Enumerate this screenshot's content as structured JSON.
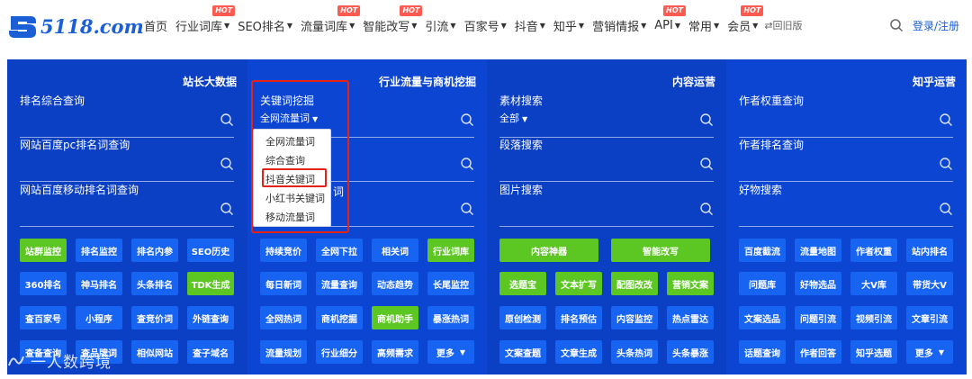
{
  "logo": {
    "text": "5118.com"
  },
  "nav": {
    "items": [
      {
        "label": "首页",
        "dropdown": false,
        "hot": ""
      },
      {
        "label": "行业词库",
        "dropdown": true,
        "hot": "HOT"
      },
      {
        "label": "SEO排名",
        "dropdown": true,
        "hot": ""
      },
      {
        "label": "流量词库",
        "dropdown": true,
        "hot": "HOT"
      },
      {
        "label": "智能改写",
        "dropdown": true,
        "hot": "HOT"
      },
      {
        "label": "引流",
        "dropdown": true,
        "hot": ""
      },
      {
        "label": "百家号",
        "dropdown": true,
        "hot": ""
      },
      {
        "label": "抖音",
        "dropdown": true,
        "hot": ""
      },
      {
        "label": "知乎",
        "dropdown": true,
        "hot": ""
      },
      {
        "label": "营销情报",
        "dropdown": true,
        "hot": ""
      },
      {
        "label": "API",
        "dropdown": true,
        "hot": "HOT"
      },
      {
        "label": "常用",
        "dropdown": true,
        "hot": ""
      },
      {
        "label": "会员",
        "dropdown": true,
        "hot": "HOT"
      }
    ],
    "old_version": "⇄回旧版",
    "login": "登录/注册"
  },
  "columns": [
    {
      "title": "站长大数据",
      "fields": [
        {
          "label": "排名综合查询",
          "sub": ""
        },
        {
          "label": "网站百度pc排名词查询",
          "sub": ""
        },
        {
          "label": "网站百度移动排名词查询",
          "sub": ""
        }
      ],
      "buttons": [
        {
          "label": "站群监控",
          "color": "green"
        },
        {
          "label": "排名监控",
          "color": "blue"
        },
        {
          "label": "排名内参",
          "color": "blue"
        },
        {
          "label": "SEO历史",
          "color": "blue"
        },
        {
          "label": "360排名",
          "color": "blue"
        },
        {
          "label": "神马排名",
          "color": "blue"
        },
        {
          "label": "头条排名",
          "color": "blue"
        },
        {
          "label": "TDK生成",
          "color": "green"
        },
        {
          "label": "查百家号",
          "color": "blue"
        },
        {
          "label": "小程序",
          "color": "blue"
        },
        {
          "label": "查竞价词",
          "color": "blue"
        },
        {
          "label": "外链查询",
          "color": "blue"
        },
        {
          "label": "查备查询",
          "color": "blue"
        },
        {
          "label": "查品牌词",
          "color": "blue"
        },
        {
          "label": "相似网站",
          "color": "blue"
        },
        {
          "label": "查子域名",
          "color": "blue"
        }
      ]
    },
    {
      "title": "行业流量与商机挖掘",
      "fields": [
        {
          "label": "关键词挖掘",
          "sub": "全网流量词"
        },
        {
          "label": "",
          "sub": ""
        },
        {
          "label": "",
          "sub": ""
        }
      ],
      "peek": "词",
      "buttons": [
        {
          "label": "持续竞价",
          "color": "blue"
        },
        {
          "label": "全网下拉",
          "color": "blue"
        },
        {
          "label": "相关词",
          "color": "blue"
        },
        {
          "label": "行业词库",
          "color": "green"
        },
        {
          "label": "每日新词",
          "color": "blue"
        },
        {
          "label": "流量查询",
          "color": "blue"
        },
        {
          "label": "动态趋势",
          "color": "blue"
        },
        {
          "label": "长尾监控",
          "color": "blue"
        },
        {
          "label": "全网热词",
          "color": "blue"
        },
        {
          "label": "商机挖掘",
          "color": "blue"
        },
        {
          "label": "商机助手",
          "color": "green"
        },
        {
          "label": "暴涨热词",
          "color": "blue"
        },
        {
          "label": "流量规划",
          "color": "blue"
        },
        {
          "label": "行业细分",
          "color": "blue"
        },
        {
          "label": "高频需求",
          "color": "blue"
        },
        {
          "label": "更多",
          "color": "more"
        }
      ]
    },
    {
      "title": "内容运营",
      "fields": [
        {
          "label": "素材搜索",
          "sub": "全部"
        },
        {
          "label": "段落搜索",
          "sub": ""
        },
        {
          "label": "图片搜索",
          "sub": ""
        }
      ],
      "buttons": [
        {
          "label": "内容神器",
          "color": "green",
          "wide": true
        },
        {
          "label": "智能改写",
          "color": "green",
          "wide": true
        },
        {
          "label": "选题宝",
          "color": "green"
        },
        {
          "label": "文本扩写",
          "color": "green"
        },
        {
          "label": "配图改改",
          "color": "green"
        },
        {
          "label": "营销文案",
          "color": "green"
        },
        {
          "label": "原创检测",
          "color": "blue"
        },
        {
          "label": "排名预估",
          "color": "blue"
        },
        {
          "label": "内容监控",
          "color": "blue"
        },
        {
          "label": "热点雷达",
          "color": "blue"
        },
        {
          "label": "文案查题",
          "color": "blue"
        },
        {
          "label": "文章生成",
          "color": "blue"
        },
        {
          "label": "头条热词",
          "color": "blue"
        },
        {
          "label": "头条暴涨",
          "color": "blue"
        }
      ]
    },
    {
      "title": "知乎运营",
      "fields": [
        {
          "label": "作者权重查询",
          "sub": ""
        },
        {
          "label": "作者排名查询",
          "sub": ""
        },
        {
          "label": "好物搜索",
          "sub": ""
        }
      ],
      "buttons": [
        {
          "label": "百度截流",
          "color": "blue"
        },
        {
          "label": "流量地图",
          "color": "blue"
        },
        {
          "label": "作者权重",
          "color": "blue"
        },
        {
          "label": "站内排名",
          "color": "blue"
        },
        {
          "label": "问题库",
          "color": "blue"
        },
        {
          "label": "好物选品",
          "color": "blue"
        },
        {
          "label": "大V库",
          "color": "blue"
        },
        {
          "label": "带货大V",
          "color": "blue"
        },
        {
          "label": "文案选品",
          "color": "blue"
        },
        {
          "label": "问题引流",
          "color": "blue"
        },
        {
          "label": "视频引流",
          "color": "blue"
        },
        {
          "label": "文章引流",
          "color": "blue"
        },
        {
          "label": "话题查询",
          "color": "blue"
        },
        {
          "label": "作者回答",
          "color": "blue"
        },
        {
          "label": "知乎选题",
          "color": "blue"
        },
        {
          "label": "更多",
          "color": "more"
        }
      ]
    }
  ],
  "dropdown": {
    "items": [
      "全网流量词",
      "综合查询",
      "抖音关键词",
      "小红书关键词",
      "移动流量词"
    ],
    "highlighted_index": 2
  },
  "watermark": {
    "text": "一人数跨境"
  },
  "colors": {
    "brand": "#1a5fd6",
    "panel": "#0c45d2",
    "button_blue": "#1763f2",
    "button_green": "#5cc623",
    "hot": "#ff5a4f",
    "annotation_red": "#e2231a"
  }
}
